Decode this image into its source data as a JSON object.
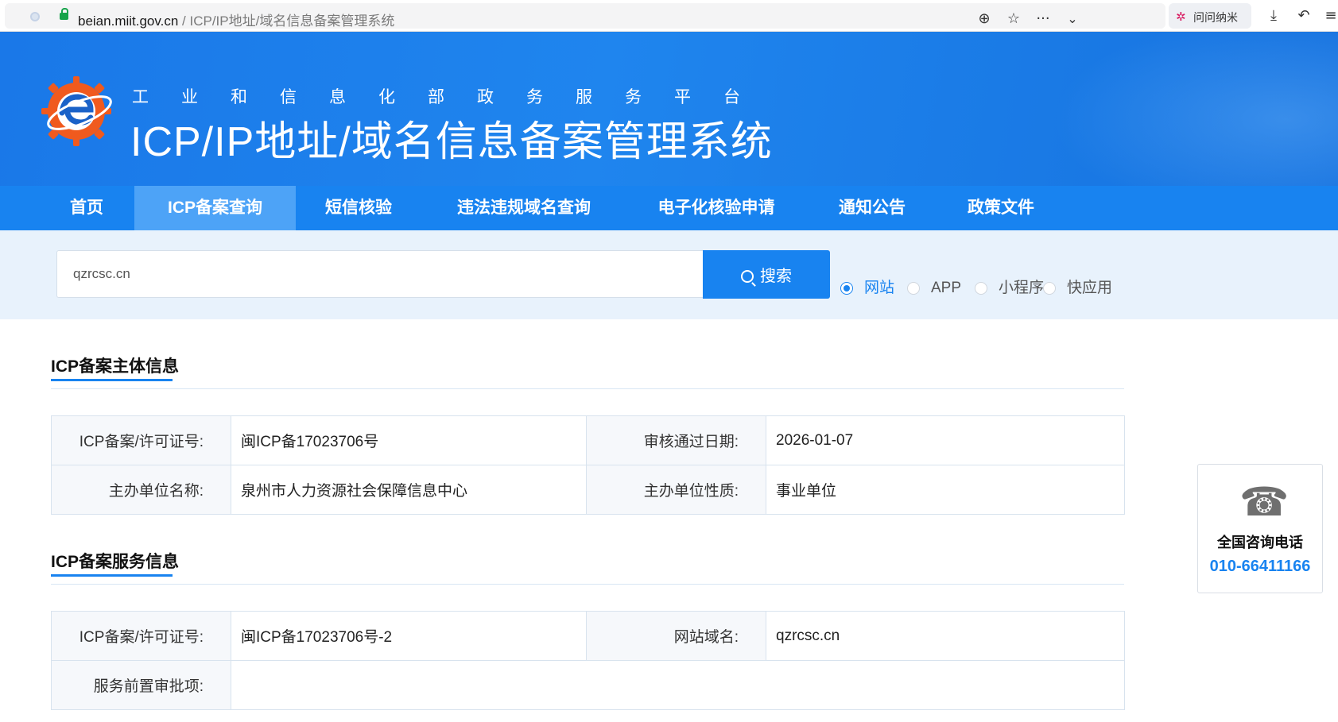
{
  "browser": {
    "url_host": "beian.miit.gov.cn",
    "url_path": " / ICP/IP地址/域名信息备案管理系统",
    "extension_label": "问问纳米",
    "icons": [
      "site-info-icon",
      "lock-icon",
      "reader-icon",
      "star-icon",
      "more-icon",
      "chevron-down-icon",
      "download-icon",
      "undo-icon",
      "menu-icon"
    ]
  },
  "header": {
    "subtitle": "工业和信息化部政务服务平台",
    "title": "ICP/IP地址/域名信息备案管理系统"
  },
  "nav": {
    "items": [
      {
        "label": "首页"
      },
      {
        "label": "ICP备案查询"
      },
      {
        "label": "短信核验"
      },
      {
        "label": "违法违规域名查询"
      },
      {
        "label": "电子化核验申请"
      },
      {
        "label": "通知公告"
      },
      {
        "label": "政策文件"
      }
    ],
    "active": "ICP备案查询"
  },
  "search": {
    "value": "qzrcsc.cn",
    "button_label": "搜索",
    "types": [
      {
        "label": "网站",
        "checked": true
      },
      {
        "label": "APP",
        "checked": false
      },
      {
        "label": "小程序",
        "checked": false
      },
      {
        "label": "快应用",
        "checked": false
      }
    ]
  },
  "subject_section": {
    "title": "ICP备案主体信息",
    "rows": [
      {
        "k1": "ICP备案/许可证号:",
        "v1": "闽ICP备17023706号",
        "k2": "审核通过日期:",
        "v2": "2026-01-07"
      },
      {
        "k1": "主办单位名称:",
        "v1": "泉州市人力资源社会保障信息中心",
        "k2": "主办单位性质:",
        "v2": "事业单位"
      }
    ]
  },
  "service_section": {
    "title": "ICP备案服务信息",
    "row1": {
      "k1": "ICP备案/许可证号:",
      "v1": "闽ICP备17023706号-2",
      "k2": "网站域名:",
      "v2": "qzrcsc.cn"
    },
    "row2": {
      "k1": "服务前置审批项:",
      "v1": ""
    }
  },
  "contact": {
    "label": "全国咨询电话",
    "number": "010-66411166"
  },
  "colors": {
    "primary": "#1883f0",
    "nav_active": "#4da3f7",
    "search_bg": "#e8f2fc",
    "logo_orange": "#f05a1e"
  }
}
